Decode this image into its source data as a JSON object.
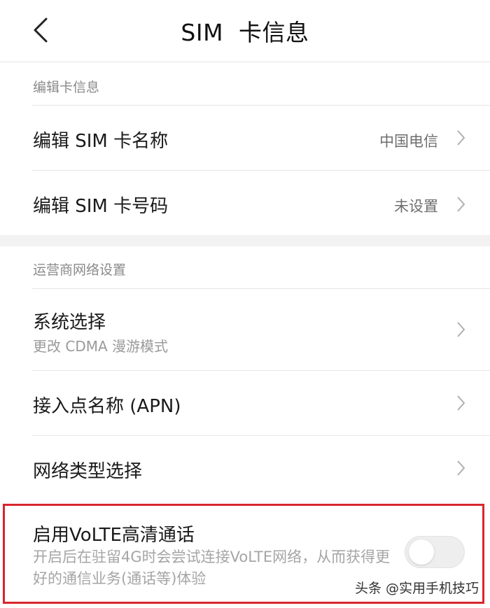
{
  "header": {
    "title": "SIM  卡信息",
    "back_icon": "chevron-left-icon"
  },
  "sections": [
    {
      "label": "编辑卡信息",
      "items": [
        {
          "title": "编辑 SIM 卡名称",
          "value": "中国电信",
          "icon": "chevron-right-icon"
        },
        {
          "title": "编辑 SIM 卡号码",
          "value": "未设置",
          "icon": "chevron-right-icon"
        }
      ]
    },
    {
      "label": "运营商网络设置",
      "items": [
        {
          "title": "系统选择",
          "subtitle": "更改 CDMA 漫游模式",
          "icon": "chevron-right-icon"
        },
        {
          "title": "接入点名称 (APN)",
          "icon": "chevron-right-icon"
        },
        {
          "title": "网络类型选择",
          "icon": "chevron-right-icon"
        }
      ]
    }
  ],
  "volte": {
    "title": "启用VoLTE高清通话",
    "description": "开启后在驻留4G时会尝试连接VoLTE网络，从而获得更好的通信业务(通话等)体验",
    "enabled": false
  },
  "watermark": "头条 @实用手机技巧",
  "colors": {
    "highlight_border": "#d8262e",
    "text_primary": "#1a1a1a",
    "text_secondary": "#8a8a8a",
    "divider": "#e6e6e6"
  }
}
